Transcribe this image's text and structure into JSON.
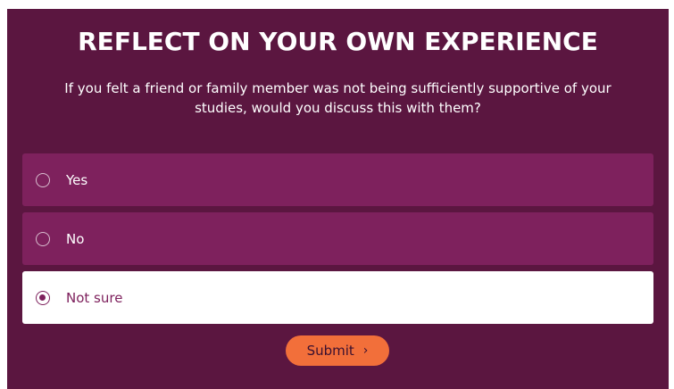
{
  "header": {
    "title": "REFLECT ON YOUR OWN EXPERIENCE",
    "question": "If you felt a friend or family member was not being sufficiently supportive of your studies, would you discuss this with them?"
  },
  "options": [
    {
      "label": "Yes",
      "selected": false
    },
    {
      "label": "No",
      "selected": false
    },
    {
      "label": "Not sure",
      "selected": true
    }
  ],
  "submit": {
    "label": "Submit",
    "icon": "chevron-right-icon"
  },
  "colors": {
    "panel_bg": "#5b1640",
    "option_bg": "#7e215d",
    "selected_bg": "#ffffff",
    "accent": "#f26f3a"
  }
}
